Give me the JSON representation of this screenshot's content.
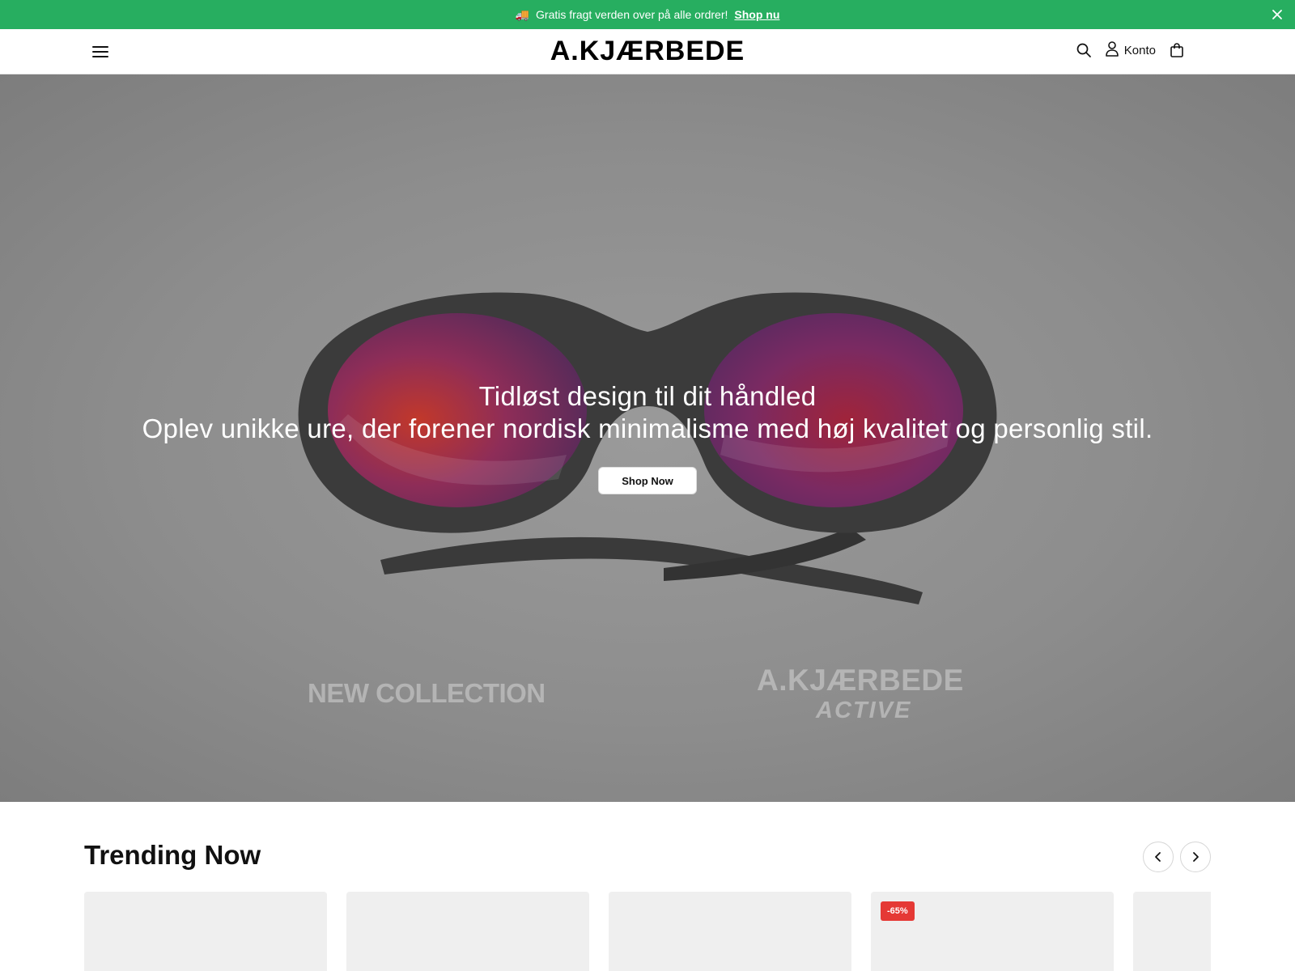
{
  "announcement": {
    "emoji": "🚚",
    "text": "Gratis fragt verden over på alle ordrer!",
    "link": "Shop nu",
    "background": "#27ae60"
  },
  "header": {
    "logo": "A.KJÆRBEDE",
    "account_label": "Konto",
    "icons": [
      "menu-icon",
      "search-icon",
      "user-icon",
      "bag-icon"
    ]
  },
  "hero": {
    "title": "Tidløst design til dit håndled",
    "subtitle": "Oplev unikke ure, der forener nordisk minimalisme med høj kvalitet og personlig stil.",
    "cta": "Shop Now",
    "image_text": {
      "collection": "NEW COLLECTION",
      "brand": "A.KJÆRBEDE",
      "line": "ACTIVE"
    }
  },
  "trending": {
    "title": "Trending Now",
    "products": [
      {
        "badge": ""
      },
      {
        "badge": ""
      },
      {
        "badge": ""
      },
      {
        "badge": "-65%"
      },
      {
        "badge": ""
      }
    ]
  },
  "colors": {
    "accent": "#27ae60",
    "badge": "#e53935"
  }
}
